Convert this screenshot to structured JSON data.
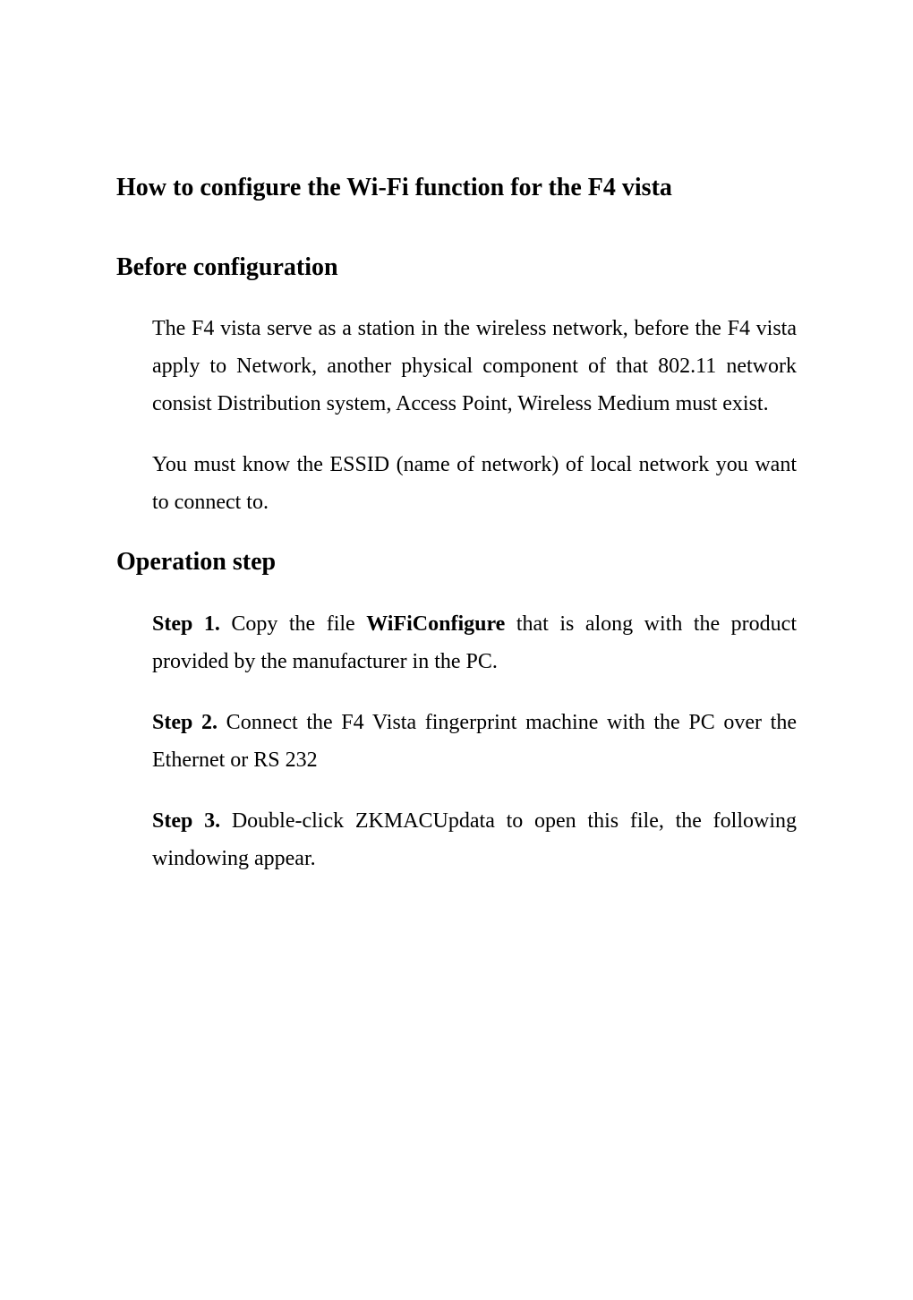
{
  "title": "How to configure the Wi-Fi function for the F4 vista",
  "section1_heading": "Before configuration",
  "section1_para1": "The F4 vista serve as a station in the wireless network, before the F4 vista apply to Network, another physical component of that 802.11 network consist Distribution system, Access Point, Wireless Medium must exist.",
  "section1_para2": "You must know the ESSID (name of network) of local network you want to connect to.",
  "section2_heading": "Operation step",
  "step1_label": "Step 1.",
  "step1_text1": " Copy the file ",
  "step1_file": "WiFiConfigure",
  "step1_text2": " that is along with the product provided by the manufacturer in the PC.",
  "step2_label": "Step 2.",
  "step2_text": " Connect the F4 Vista fingerprint machine with the PC over the Ethernet or RS 232",
  "step3_label": "Step 3.",
  "step3_text": " Double-click ZKMACUpdata to open this file, the following windowing appear."
}
